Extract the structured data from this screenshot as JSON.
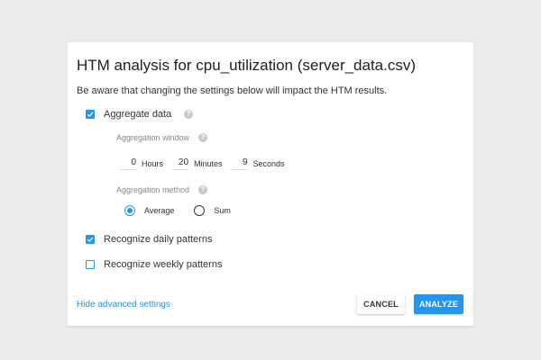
{
  "dialog": {
    "title": "HTM analysis for cpu_utilization (server_data.csv)",
    "warning": "Be aware that changing the settings below will impact the HTM results."
  },
  "aggregate": {
    "label": "Aggregate data",
    "checked": true,
    "help_icon": "?",
    "window": {
      "label": "Aggregation window",
      "help_icon": "?",
      "hours_value": "0",
      "hours_label": "Hours",
      "minutes_value": "20",
      "minutes_label": "Minutes",
      "seconds_value": "9",
      "seconds_label": "Seconds"
    },
    "method": {
      "label": "Aggregation method",
      "help_icon": "?",
      "average_label": "Average",
      "sum_label": "Sum",
      "selected": "Average"
    }
  },
  "daily": {
    "label": "Recognize daily patterns",
    "checked": true
  },
  "weekly": {
    "label": "Recognize weekly patterns",
    "checked": false
  },
  "footer": {
    "advanced_link": "Hide advanced settings",
    "cancel_label": "CANCEL",
    "analyze_label": "ANALYZE"
  },
  "colors": {
    "accent": "#2196f3",
    "background": "#ececec",
    "dialog": "#ffffff"
  },
  "icons": {
    "checkbox_checked": "checkbox-checked-icon",
    "checkbox_unchecked": "checkbox-unchecked-icon",
    "help": "help-icon",
    "radio_selected": "radio-selected-icon",
    "radio_unselected": "radio-unselected-icon"
  }
}
